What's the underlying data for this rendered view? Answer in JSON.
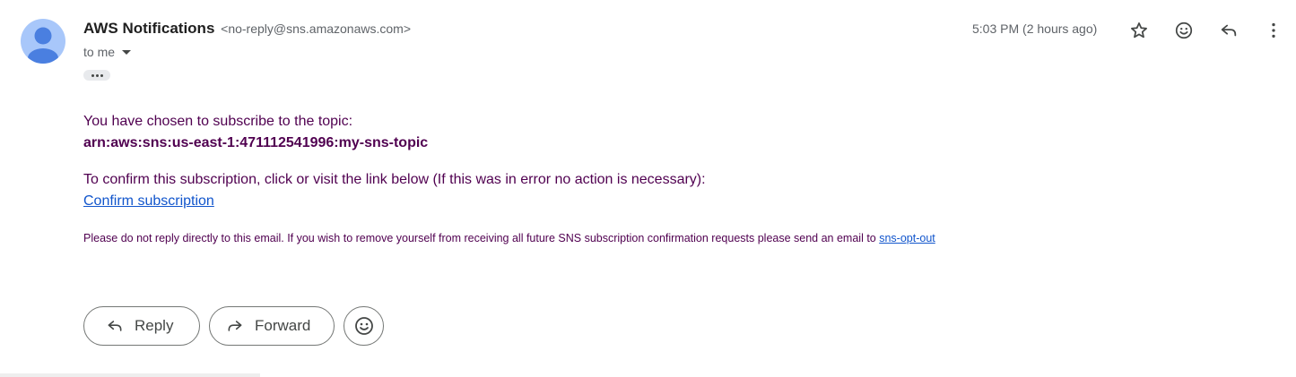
{
  "message": {
    "sender_name": "AWS Notifications",
    "sender_email": "<no-reply@sns.amazonaws.com>",
    "recipient_label": "to me",
    "timestamp": "5:03 PM (2 hours ago)"
  },
  "body": {
    "line1": "You have chosen to subscribe to the topic:",
    "topic_arn": "arn:aws:sns:us-east-1:471112541996:my-sns-topic",
    "line2": "To confirm this subscription, click or visit the link below (If this was in error no action is necessary):",
    "confirm_link": "Confirm subscription",
    "footer": "Please do not reply directly to this email. If you wish to remove yourself from receiving all future SNS subscription confirmation requests please send an email to ",
    "opt_out_link": "sns-opt-out"
  },
  "actions": {
    "reply_label": "Reply",
    "forward_label": "Forward"
  },
  "icons": {
    "avatar": "person-avatar-icon",
    "star": "star-icon",
    "emoji": "emoji-react-icon",
    "reply": "reply-icon",
    "more": "more-vert-icon",
    "forward": "forward-icon"
  },
  "colors": {
    "avatar_bg": "#a8c7fa",
    "avatar_fg": "#4a7fe0",
    "body_text": "#500050",
    "link": "#1155cc"
  }
}
